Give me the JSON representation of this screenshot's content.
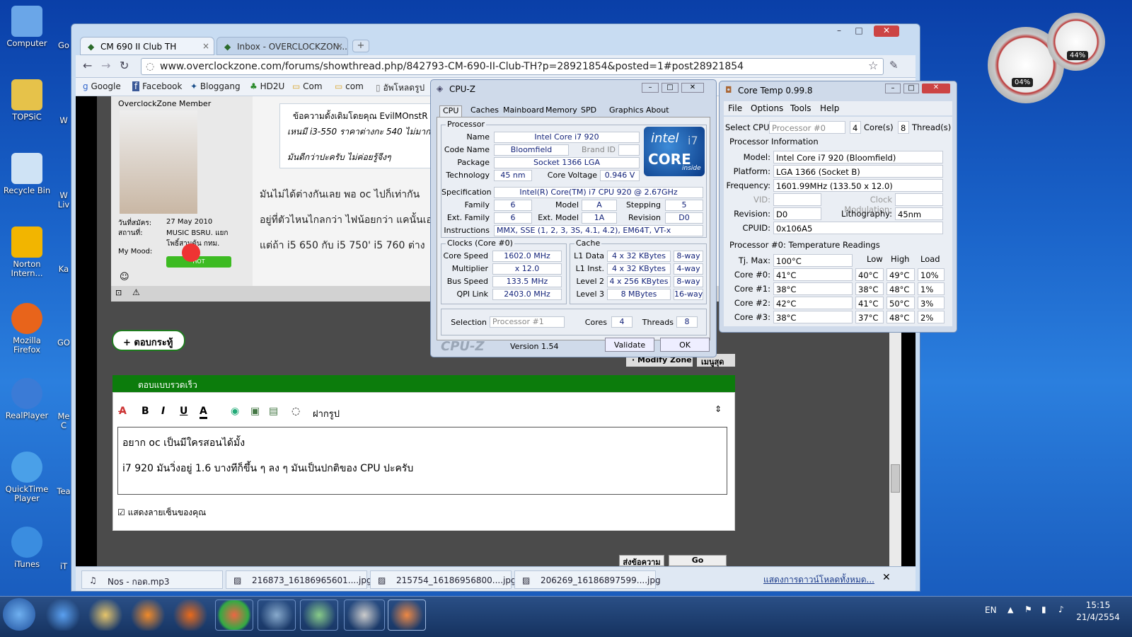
{
  "desktop_icons": [
    {
      "label": "Computer",
      "icon": "computer-icon",
      "color": "#6aa6e8"
    },
    {
      "label": "TOPSiC",
      "icon": "folder-icon",
      "color": "#e6c24a"
    },
    {
      "label": "Recycle Bin",
      "icon": "recycle-bin-icon",
      "color": "#cfe3f5"
    },
    {
      "label": "Norton Intern...",
      "icon": "norton-icon",
      "color": "#f2b500"
    },
    {
      "label": "Mozilla Firefox",
      "icon": "firefox-icon",
      "color": "#e8641b"
    },
    {
      "label": "RealPlayer",
      "icon": "realplayer-icon",
      "color": "#3b7bd6"
    },
    {
      "label": "QuickTime Player",
      "icon": "quicktime-icon",
      "color": "#4aa0e8"
    },
    {
      "label": "iTunes",
      "icon": "itunes-icon",
      "color": "#3a8de0"
    }
  ],
  "desktop_icons_col2": [
    "Go",
    "W",
    "W Liv",
    "Ka",
    "GO",
    "Me C",
    "Tea",
    "iT"
  ],
  "browser": {
    "tabs": [
      {
        "label": "CM 690 II Club TH",
        "active": true
      },
      {
        "label": "Inbox - OVERCLOCKZON...",
        "active": false
      }
    ],
    "url": "www.overclockzone.com/forums/showthread.php/842793-CM-690-II-Club-TH?p=28921854&posted=1#post28921854",
    "bookmarks": [
      "Google",
      "Facebook",
      "Bloggang",
      "HD2U",
      "Com",
      "com",
      "อัพโหลดรูป"
    ],
    "window_buttons": [
      "–",
      "□",
      "✕"
    ]
  },
  "post": {
    "member_title": "OverclockZone Member",
    "join_label": "วันที่สมัคร:",
    "join_value": "27 May 2010",
    "location_label": "สถานที่:",
    "location_value": "MUSIC BSRU. แยก โพธิ์สามต้น กทม.",
    "mood_label": "My Mood:",
    "mood_badge": "HOT",
    "quote_header": "ข้อความดั้งเดิมโดยคุณ EvilMOnstR",
    "quote_line1": "เหนมี i3-550 ราคาต่างกะ 540 ไม่มาก",
    "quote_line2": "มันดีกว่าปะครับ ไม่ค่อยรู้จีงๆ",
    "line1": "มันไม่ได้ต่างกันเลย พอ oc ไปก็เท่ากัน",
    "line2": "อยู่ที่ตัวไหนไกลกว่า ไฟน้อยกว่า แคนั้นเอ",
    "line3": "แต่ถ้า i5 650 กับ i5 750' i5 760 ต่าง"
  },
  "reply_button": "+ ตอบกระทู้",
  "modify_buttons": [
    "· Modify Zone",
    "เมนูสุด"
  ],
  "quick_reply": {
    "header": "ตอบแบบรวดเร็ว",
    "toolbar": [
      "B",
      "I",
      "U",
      "A"
    ],
    "smiley_label": "ฝากรูป",
    "text_line1": "อยาก oc เป็นมีใครสอนได้มั้ง",
    "text_line2": "i7 920 มันวิ่งอยู่ 1.6 บางทีก็ขึ้น ๆ ลง ๆ มันเป็นปกติของ CPU ปะครับ",
    "signature_label": "แสดงลายเซ็นของคุณ",
    "submit": "ส่งข้อความ",
    "advanced": "Go Advanced"
  },
  "downloads": {
    "items": [
      "Nos - กอด.mp3",
      "216873_16186965601....jpg",
      "215754_16186956800....jpg",
      "206269_16186897599....jpg"
    ],
    "show_all": "แสดงการดาวน์โหลดทั้งหมด..."
  },
  "cpuz": {
    "title": "CPU-Z",
    "tabs": [
      "CPU",
      "Caches",
      "Mainboard",
      "Memory",
      "SPD",
      "Graphics",
      "About"
    ],
    "processor_label": "Processor",
    "name_l": "Name",
    "name": "Intel Core i7 920",
    "codename_l": "Code Name",
    "codename": "Bloomfield",
    "brandid_l": "Brand ID",
    "package_l": "Package",
    "package": "Socket 1366 LGA",
    "tech_l": "Technology",
    "tech": "45 nm",
    "cv_l": "Core Voltage",
    "cv": "0.946 V",
    "spec_l": "Specification",
    "spec": "Intel(R) Core(TM) i7 CPU       920  @ 2.67GHz",
    "family_l": "Family",
    "family": "6",
    "model_l": "Model",
    "model": "A",
    "stepping_l": "Stepping",
    "stepping": "5",
    "extfam_l": "Ext. Family",
    "extfam": "6",
    "extmodel_l": "Ext. Model",
    "extmodel": "1A",
    "revision_l": "Revision",
    "revision": "D0",
    "instr_l": "Instructions",
    "instr": "MMX, SSE (1, 2, 3, 3S, 4.1, 4.2), EM64T, VT-x",
    "clocks_label": "Clocks (Core #0)",
    "corespeed_l": "Core Speed",
    "corespeed": "1602.0 MHz",
    "mult_l": "Multiplier",
    "mult": "x 12.0",
    "bus_l": "Bus Speed",
    "bus": "133.5 MHz",
    "qpi_l": "QPI Link",
    "qpi": "2403.0 MHz",
    "cache_label": "Cache",
    "l1d_l": "L1 Data",
    "l1d": "4 x 32 KBytes",
    "l1d_w": "8-way",
    "l1i_l": "L1 Inst.",
    "l1i": "4 x 32 KBytes",
    "l1i_w": "4-way",
    "l2_l": "Level 2",
    "l2": "4 x 256 KBytes",
    "l2_w": "8-way",
    "l3_l": "Level 3",
    "l3": "8 MBytes",
    "l3_w": "16-way",
    "sel_l": "Selection",
    "sel": "Processor #1",
    "cores_l": "Cores",
    "cores": "4",
    "threads_l": "Threads",
    "threads": "8",
    "brand": "CPU-Z",
    "version": "Version 1.54",
    "validate": "Validate",
    "ok": "OK",
    "logo_intel": "intel",
    "logo_core": "CORE",
    "logo_inside": "inside",
    "logo_i7": "i7"
  },
  "coretemp": {
    "title": "Core Temp 0.99.8",
    "menu": [
      "File",
      "Options",
      "Tools",
      "Help"
    ],
    "select_l": "Select CPU:",
    "select": "Processor #0",
    "cores_n": "4",
    "cores_l": "Core(s)",
    "threads_n": "8",
    "threads_l": "Thread(s)",
    "info_label": "Processor Information",
    "model_l": "Model:",
    "model": "Intel Core i7 920 (Bloomfield)",
    "platform_l": "Platform:",
    "platform": "LGA 1366 (Socket B)",
    "freq_l": "Frequency:",
    "freq": "1601.99MHz (133.50 x 12.0)",
    "vid_l": "VID:",
    "clockmod_l": "Clock Modulation:",
    "rev_l": "Revision:",
    "rev": "D0",
    "litho_l": "Lithography:",
    "litho": "45nm",
    "cpuid_l": "CPUID:",
    "cpuid": "0x106A5",
    "temps_label": "Processor #0: Temperature Readings",
    "col_low": "Low",
    "col_high": "High",
    "col_load": "Load",
    "tjmax_l": "Tj. Max:",
    "tjmax": "100°C",
    "cores": [
      {
        "name": "Core #0:",
        "temp": "41°C",
        "low": "40°C",
        "high": "49°C",
        "load": "10%"
      },
      {
        "name": "Core #1:",
        "temp": "38°C",
        "low": "38°C",
        "high": "48°C",
        "load": "1%"
      },
      {
        "name": "Core #2:",
        "temp": "42°C",
        "low": "41°C",
        "high": "50°C",
        "load": "3%"
      },
      {
        "name": "Core #3:",
        "temp": "38°C",
        "low": "37°C",
        "high": "48°C",
        "load": "2%"
      }
    ]
  },
  "gadget": {
    "cpu": "04%",
    "ram": "44%"
  },
  "taskbar": {
    "lang": "EN",
    "time": "15:15",
    "date": "21/4/2554"
  }
}
